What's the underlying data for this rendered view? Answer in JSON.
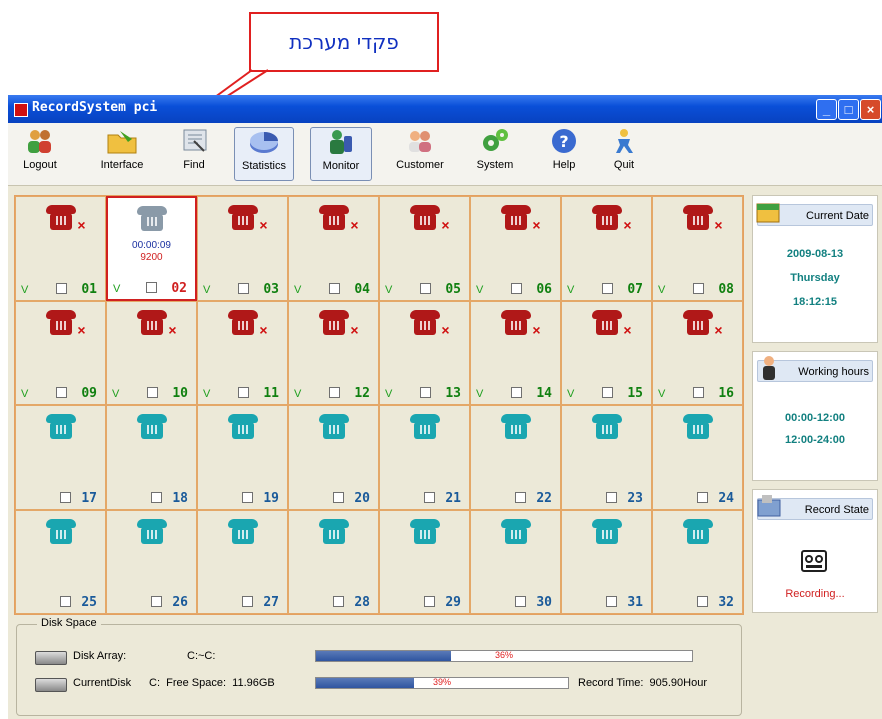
{
  "annotation": {
    "label": "פקדי מערכת"
  },
  "window": {
    "title": "RecordSystem pci"
  },
  "toolbar": {
    "buttons": [
      {
        "label": "Logout"
      },
      {
        "label": "Interface"
      },
      {
        "label": "Find"
      },
      {
        "label": "Statistics"
      },
      {
        "label": "Monitor"
      },
      {
        "label": "Customer"
      },
      {
        "label": "System"
      },
      {
        "label": "Help"
      },
      {
        "label": "Quit"
      }
    ]
  },
  "channels": [
    {
      "number": "01",
      "state": "red",
      "v": "V"
    },
    {
      "number": "02",
      "state": "active",
      "v": "V",
      "time": "00:00:09",
      "ext": "9200"
    },
    {
      "number": "03",
      "state": "red",
      "v": "V"
    },
    {
      "number": "04",
      "state": "red",
      "v": "V"
    },
    {
      "number": "05",
      "state": "red",
      "v": "V"
    },
    {
      "number": "06",
      "state": "red",
      "v": "V"
    },
    {
      "number": "07",
      "state": "red",
      "v": "V"
    },
    {
      "number": "08",
      "state": "red",
      "v": "V"
    },
    {
      "number": "09",
      "state": "red",
      "v": "V"
    },
    {
      "number": "10",
      "state": "red",
      "v": "V"
    },
    {
      "number": "11",
      "state": "red",
      "v": "V"
    },
    {
      "number": "12",
      "state": "red",
      "v": "V"
    },
    {
      "number": "13",
      "state": "red",
      "v": "V"
    },
    {
      "number": "14",
      "state": "red",
      "v": "V"
    },
    {
      "number": "15",
      "state": "red",
      "v": "V"
    },
    {
      "number": "16",
      "state": "red",
      "v": "V"
    },
    {
      "number": "17",
      "state": "teal"
    },
    {
      "number": "18",
      "state": "teal"
    },
    {
      "number": "19",
      "state": "teal"
    },
    {
      "number": "20",
      "state": "teal"
    },
    {
      "number": "21",
      "state": "teal"
    },
    {
      "number": "22",
      "state": "teal"
    },
    {
      "number": "23",
      "state": "teal"
    },
    {
      "number": "24",
      "state": "teal"
    },
    {
      "number": "25",
      "state": "teal"
    },
    {
      "number": "26",
      "state": "teal"
    },
    {
      "number": "27",
      "state": "teal"
    },
    {
      "number": "28",
      "state": "teal"
    },
    {
      "number": "29",
      "state": "teal"
    },
    {
      "number": "30",
      "state": "teal"
    },
    {
      "number": "31",
      "state": "teal"
    },
    {
      "number": "32",
      "state": "teal"
    }
  ],
  "current_date": {
    "heading": "Current Date",
    "date": "2009-08-13",
    "weekday": "Thursday",
    "time": "18:12:15"
  },
  "working_hours": {
    "heading": "Working hours",
    "range1": "00:00-12:00",
    "range2": "12:00-24:00"
  },
  "record_state": {
    "heading": "Record State",
    "status": "Recording..."
  },
  "disk_space": {
    "legend": "Disk Space",
    "array_label": "Disk Array:",
    "array_path": "C:~C:",
    "array_usage": 36,
    "array_usage_text": "36%",
    "current_label": "CurrentDisk",
    "current_free": "C:  Free Space:  11.96GB",
    "current_usage": 39,
    "current_usage_text": "39%",
    "record_time": "Record Time:  905.90Hour"
  },
  "colors": {
    "title_bar": "#0a4fd8",
    "cell_border": "#e4a868",
    "status_text": "#128080",
    "recording": "#d02020"
  }
}
